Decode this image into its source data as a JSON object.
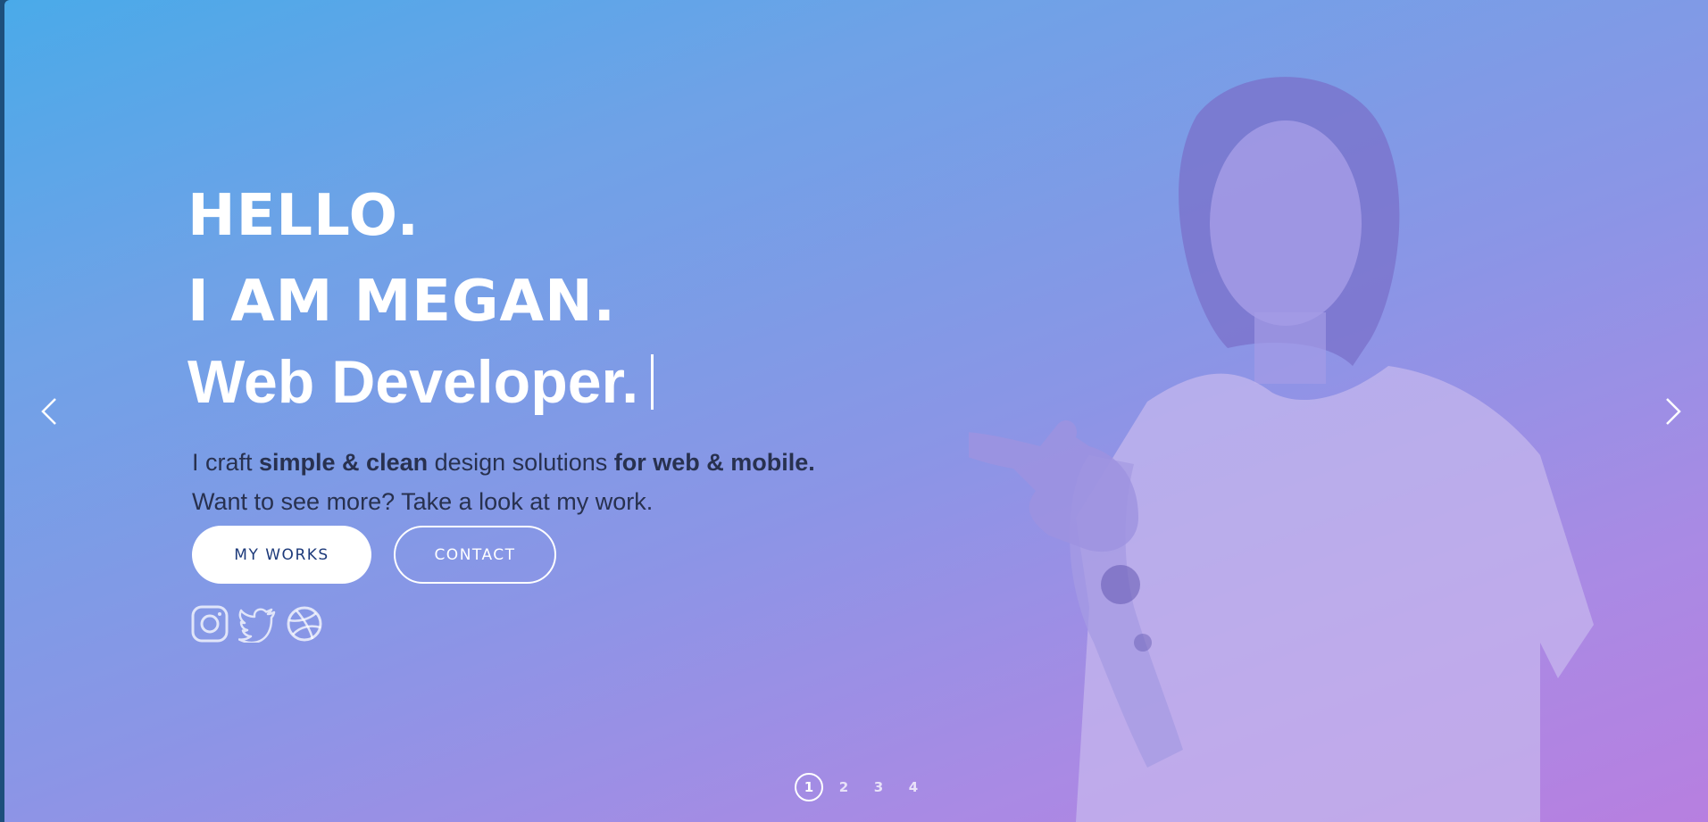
{
  "hero": {
    "line1": "HELLO.",
    "line2": "I AM MEGAN.",
    "line3": "Web Developer.",
    "intro": {
      "p1_a": "I craft ",
      "p1_b": "simple & clean",
      "p1_c": " design solutions ",
      "p1_d": "for web & mobile.",
      "p2": "Want to see more? Take a look at my work."
    }
  },
  "buttons": {
    "primary_label": "MY WORKS",
    "secondary_label": "CONTACT"
  },
  "social": [
    "instagram-icon",
    "twitter-icon",
    "dribbble-icon"
  ],
  "slider": {
    "dots": [
      "1",
      "2",
      "3",
      "4"
    ],
    "active": 1
  },
  "colors": {
    "gradient_start": "#4aaae9",
    "gradient_end": "#b77fe0",
    "text_dark": "#28314f",
    "button_text": "#1d3a7a"
  }
}
